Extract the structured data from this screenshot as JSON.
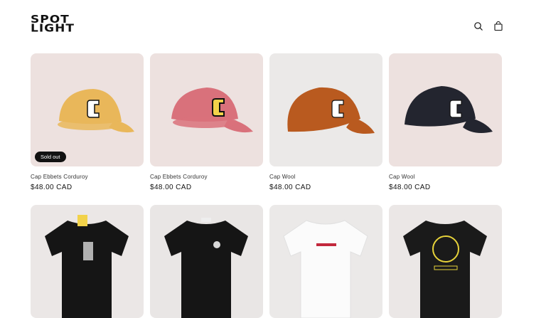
{
  "brand": {
    "logo_line1": "SPOT",
    "logo_line2": "LIGHT"
  },
  "header": {
    "icons": [
      "search-icon",
      "cart-icon"
    ]
  },
  "products": [
    {
      "title": "Cap Ebbets Corduroy",
      "price": "$48.00 CAD",
      "badge": "Sold out",
      "bg": "#ede1df",
      "color": "#e9b75a"
    },
    {
      "title": "Cap Ebbets Corduroy",
      "price": "$48.00 CAD",
      "badge": "",
      "bg": "#ede1df",
      "color": "#d9717b"
    },
    {
      "title": "Cap Wool",
      "price": "$48.00 CAD",
      "badge": "",
      "bg": "#ebe9e8",
      "color": "#b95a1f"
    },
    {
      "title": "Cap Wool",
      "price": "$48.00 CAD",
      "badge": "",
      "bg": "#ede1df",
      "color": "#23252f"
    },
    {
      "title": "",
      "price": "",
      "badge": "",
      "bg": "#ebe7e6",
      "color": "#151515"
    },
    {
      "title": "",
      "price": "",
      "badge": "",
      "bg": "#e9e6e5",
      "color": "#151515"
    },
    {
      "title": "",
      "price": "",
      "badge": "",
      "bg": "#ebe9e8",
      "color": "#fbfbfb"
    },
    {
      "title": "",
      "price": "",
      "badge": "",
      "bg": "#ebe7e6",
      "color": "#1a1a1a"
    }
  ]
}
